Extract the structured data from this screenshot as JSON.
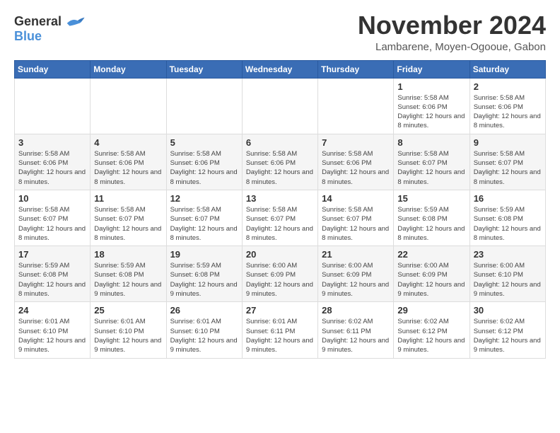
{
  "header": {
    "logo_general": "General",
    "logo_blue": "Blue",
    "month_title": "November 2024",
    "location": "Lambarene, Moyen-Ogooue, Gabon"
  },
  "days_of_week": [
    "Sunday",
    "Monday",
    "Tuesday",
    "Wednesday",
    "Thursday",
    "Friday",
    "Saturday"
  ],
  "weeks": [
    [
      {
        "day": "",
        "info": ""
      },
      {
        "day": "",
        "info": ""
      },
      {
        "day": "",
        "info": ""
      },
      {
        "day": "",
        "info": ""
      },
      {
        "day": "",
        "info": ""
      },
      {
        "day": "1",
        "info": "Sunrise: 5:58 AM\nSunset: 6:06 PM\nDaylight: 12 hours and 8 minutes."
      },
      {
        "day": "2",
        "info": "Sunrise: 5:58 AM\nSunset: 6:06 PM\nDaylight: 12 hours and 8 minutes."
      }
    ],
    [
      {
        "day": "3",
        "info": "Sunrise: 5:58 AM\nSunset: 6:06 PM\nDaylight: 12 hours and 8 minutes."
      },
      {
        "day": "4",
        "info": "Sunrise: 5:58 AM\nSunset: 6:06 PM\nDaylight: 12 hours and 8 minutes."
      },
      {
        "day": "5",
        "info": "Sunrise: 5:58 AM\nSunset: 6:06 PM\nDaylight: 12 hours and 8 minutes."
      },
      {
        "day": "6",
        "info": "Sunrise: 5:58 AM\nSunset: 6:06 PM\nDaylight: 12 hours and 8 minutes."
      },
      {
        "day": "7",
        "info": "Sunrise: 5:58 AM\nSunset: 6:06 PM\nDaylight: 12 hours and 8 minutes."
      },
      {
        "day": "8",
        "info": "Sunrise: 5:58 AM\nSunset: 6:07 PM\nDaylight: 12 hours and 8 minutes."
      },
      {
        "day": "9",
        "info": "Sunrise: 5:58 AM\nSunset: 6:07 PM\nDaylight: 12 hours and 8 minutes."
      }
    ],
    [
      {
        "day": "10",
        "info": "Sunrise: 5:58 AM\nSunset: 6:07 PM\nDaylight: 12 hours and 8 minutes."
      },
      {
        "day": "11",
        "info": "Sunrise: 5:58 AM\nSunset: 6:07 PM\nDaylight: 12 hours and 8 minutes."
      },
      {
        "day": "12",
        "info": "Sunrise: 5:58 AM\nSunset: 6:07 PM\nDaylight: 12 hours and 8 minutes."
      },
      {
        "day": "13",
        "info": "Sunrise: 5:58 AM\nSunset: 6:07 PM\nDaylight: 12 hours and 8 minutes."
      },
      {
        "day": "14",
        "info": "Sunrise: 5:58 AM\nSunset: 6:07 PM\nDaylight: 12 hours and 8 minutes."
      },
      {
        "day": "15",
        "info": "Sunrise: 5:59 AM\nSunset: 6:08 PM\nDaylight: 12 hours and 8 minutes."
      },
      {
        "day": "16",
        "info": "Sunrise: 5:59 AM\nSunset: 6:08 PM\nDaylight: 12 hours and 8 minutes."
      }
    ],
    [
      {
        "day": "17",
        "info": "Sunrise: 5:59 AM\nSunset: 6:08 PM\nDaylight: 12 hours and 8 minutes."
      },
      {
        "day": "18",
        "info": "Sunrise: 5:59 AM\nSunset: 6:08 PM\nDaylight: 12 hours and 9 minutes."
      },
      {
        "day": "19",
        "info": "Sunrise: 5:59 AM\nSunset: 6:08 PM\nDaylight: 12 hours and 9 minutes."
      },
      {
        "day": "20",
        "info": "Sunrise: 6:00 AM\nSunset: 6:09 PM\nDaylight: 12 hours and 9 minutes."
      },
      {
        "day": "21",
        "info": "Sunrise: 6:00 AM\nSunset: 6:09 PM\nDaylight: 12 hours and 9 minutes."
      },
      {
        "day": "22",
        "info": "Sunrise: 6:00 AM\nSunset: 6:09 PM\nDaylight: 12 hours and 9 minutes."
      },
      {
        "day": "23",
        "info": "Sunrise: 6:00 AM\nSunset: 6:10 PM\nDaylight: 12 hours and 9 minutes."
      }
    ],
    [
      {
        "day": "24",
        "info": "Sunrise: 6:01 AM\nSunset: 6:10 PM\nDaylight: 12 hours and 9 minutes."
      },
      {
        "day": "25",
        "info": "Sunrise: 6:01 AM\nSunset: 6:10 PM\nDaylight: 12 hours and 9 minutes."
      },
      {
        "day": "26",
        "info": "Sunrise: 6:01 AM\nSunset: 6:10 PM\nDaylight: 12 hours and 9 minutes."
      },
      {
        "day": "27",
        "info": "Sunrise: 6:01 AM\nSunset: 6:11 PM\nDaylight: 12 hours and 9 minutes."
      },
      {
        "day": "28",
        "info": "Sunrise: 6:02 AM\nSunset: 6:11 PM\nDaylight: 12 hours and 9 minutes."
      },
      {
        "day": "29",
        "info": "Sunrise: 6:02 AM\nSunset: 6:12 PM\nDaylight: 12 hours and 9 minutes."
      },
      {
        "day": "30",
        "info": "Sunrise: 6:02 AM\nSunset: 6:12 PM\nDaylight: 12 hours and 9 minutes."
      }
    ]
  ]
}
